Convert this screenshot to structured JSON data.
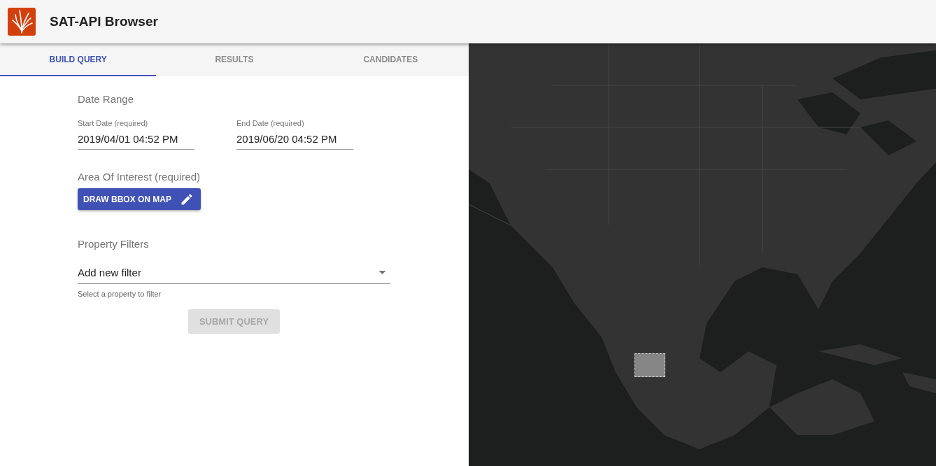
{
  "header": {
    "title": "SAT-API Browser"
  },
  "tabs": [
    {
      "label": "BUILD QUERY",
      "selected": true
    },
    {
      "label": "RESULTS",
      "selected": false
    },
    {
      "label": "CANDIDATES",
      "selected": false
    }
  ],
  "date_range": {
    "heading": "Date Range",
    "fields": [
      {
        "label": "Start Date (required)",
        "value": "2019/04/01 04:52 PM"
      },
      {
        "label": "End Date (required)",
        "value": "2019/06/20 04:52 PM"
      }
    ]
  },
  "area_of_interest": {
    "heading": "Area Of Interest (required)",
    "button": "DRAW BBOX ON MAP"
  },
  "property_filters": {
    "heading": "Property Filters",
    "select": {
      "value": "Add new filter",
      "helper": "Select a property to filter"
    }
  },
  "submit": {
    "label": "SUBMIT QUERY",
    "disabled": true
  }
}
